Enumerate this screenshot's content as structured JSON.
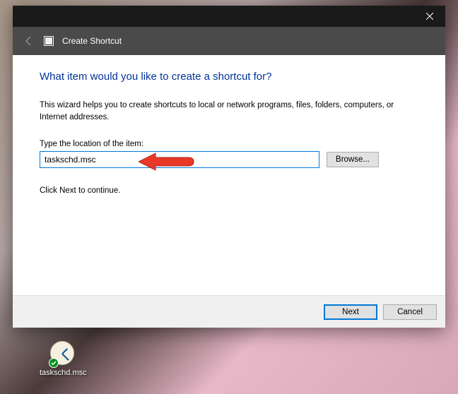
{
  "dialog": {
    "title": "Create Shortcut",
    "heading": "What item would you like to create a shortcut for?",
    "description": "This wizard helps you to create shortcuts to local or network programs, files, folders, computers, or Internet addresses.",
    "location_label": "Type the location of the item:",
    "location_value": "taskschd.msc",
    "browse_label": "Browse...",
    "continue_text": "Click Next to continue.",
    "next_label": "Next",
    "cancel_label": "Cancel"
  },
  "desktop": {
    "icon_label": "taskschd.msc"
  }
}
